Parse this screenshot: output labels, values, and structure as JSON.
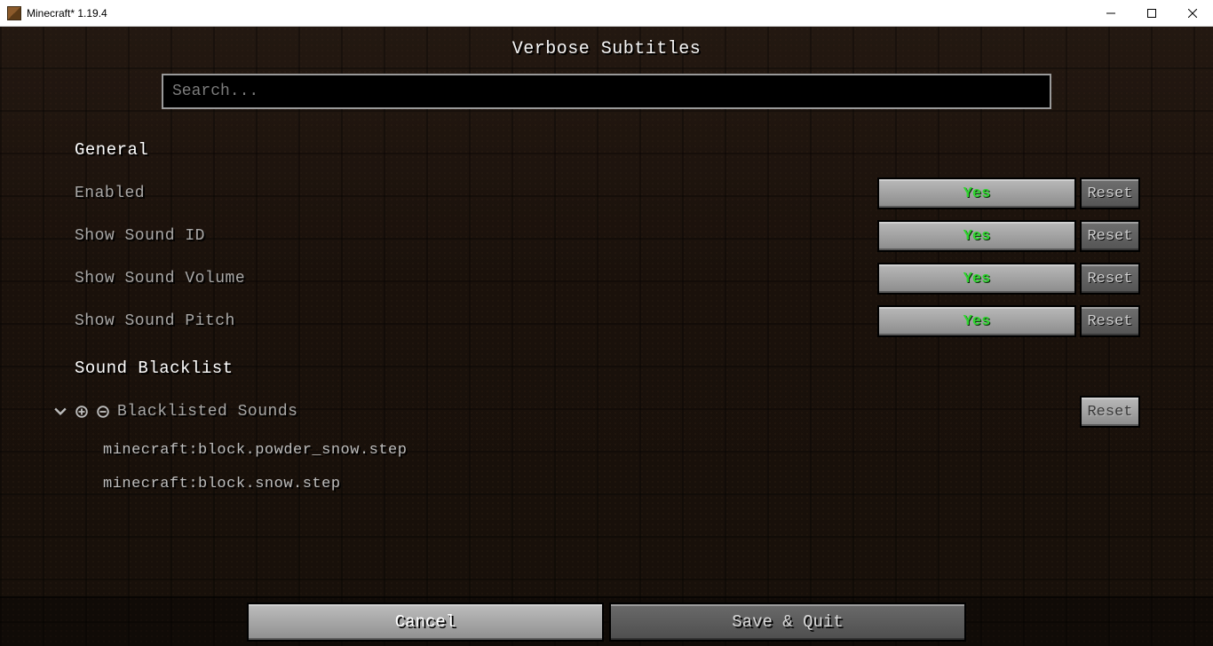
{
  "window": {
    "title": "Minecraft* 1.19.4"
  },
  "page": {
    "title": "Verbose Subtitles",
    "search_placeholder": "Search..."
  },
  "sections": {
    "general": {
      "header": "General",
      "rows": {
        "enabled": {
          "label": "Enabled",
          "value": "Yes",
          "reset": "Reset"
        },
        "sound_id": {
          "label": "Show Sound ID",
          "value": "Yes",
          "reset": "Reset"
        },
        "sound_vol": {
          "label": "Show Sound Volume",
          "value": "Yes",
          "reset": "Reset"
        },
        "sound_pit": {
          "label": "Show Sound Pitch",
          "value": "Yes",
          "reset": "Reset"
        }
      }
    },
    "blacklist": {
      "header": "Sound Blacklist",
      "row_label": "Blacklisted Sounds",
      "reset": "Reset",
      "entries": [
        "minecraft:block.powder_snow.step",
        "minecraft:block.snow.step"
      ]
    }
  },
  "footer": {
    "cancel": "Cancel",
    "save": "Save & Quit"
  }
}
